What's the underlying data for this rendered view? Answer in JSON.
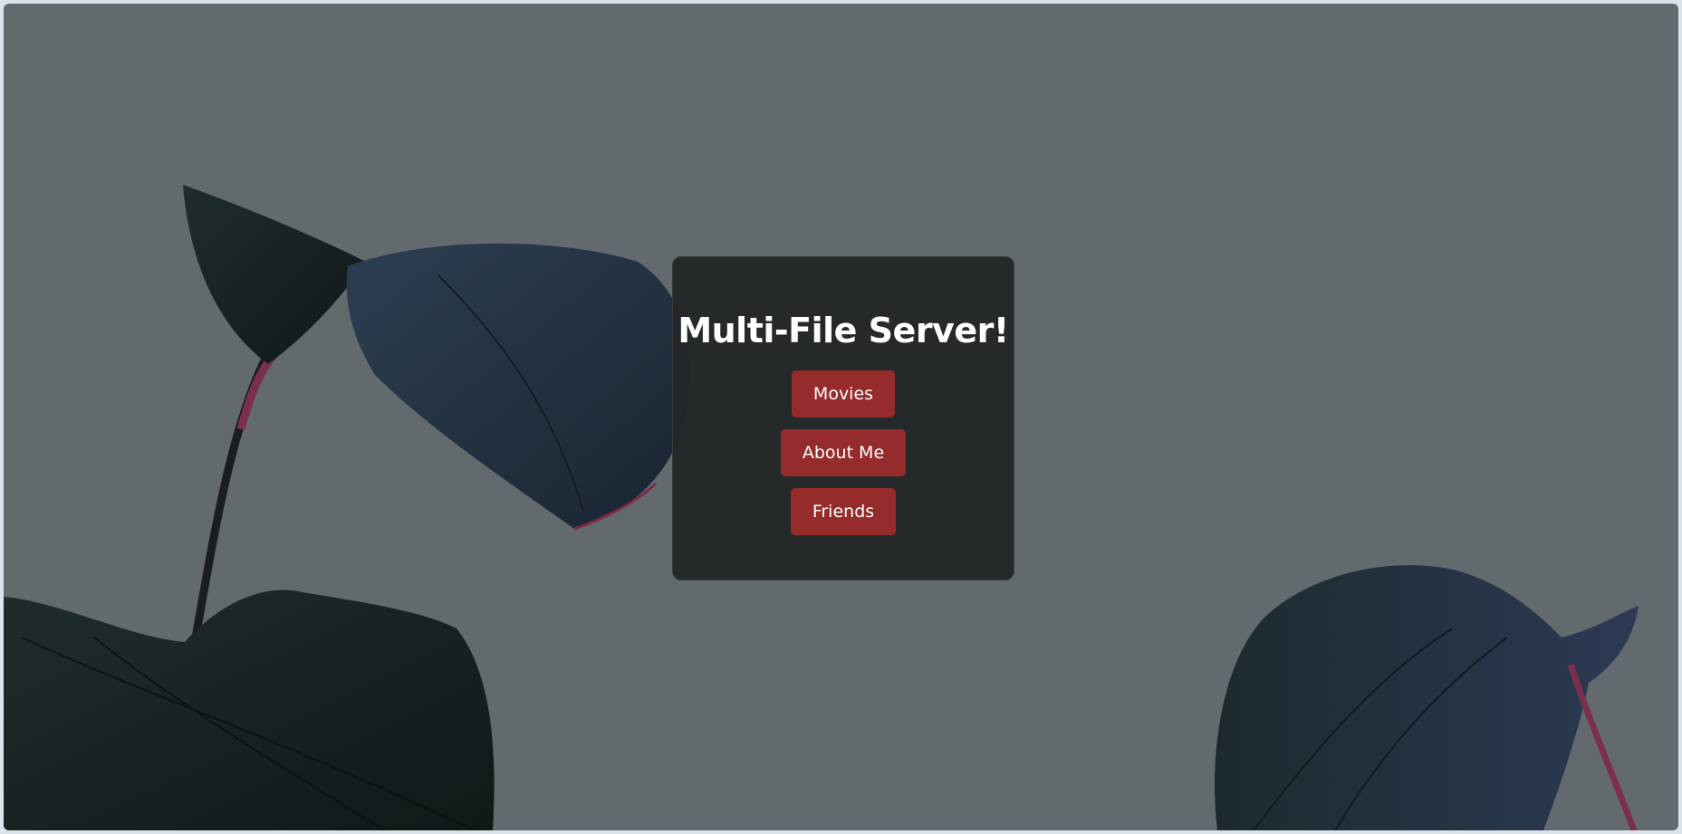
{
  "page": {
    "title": "Multi-File Server!",
    "background_color": "#626a6d",
    "card_color": "#232628",
    "accent_color": "#952b2b"
  },
  "nav": {
    "buttons": [
      {
        "label": "Movies"
      },
      {
        "label": "About Me"
      },
      {
        "label": "Friends"
      }
    ]
  },
  "background_image": {
    "icon": "plant-leaves-image"
  }
}
